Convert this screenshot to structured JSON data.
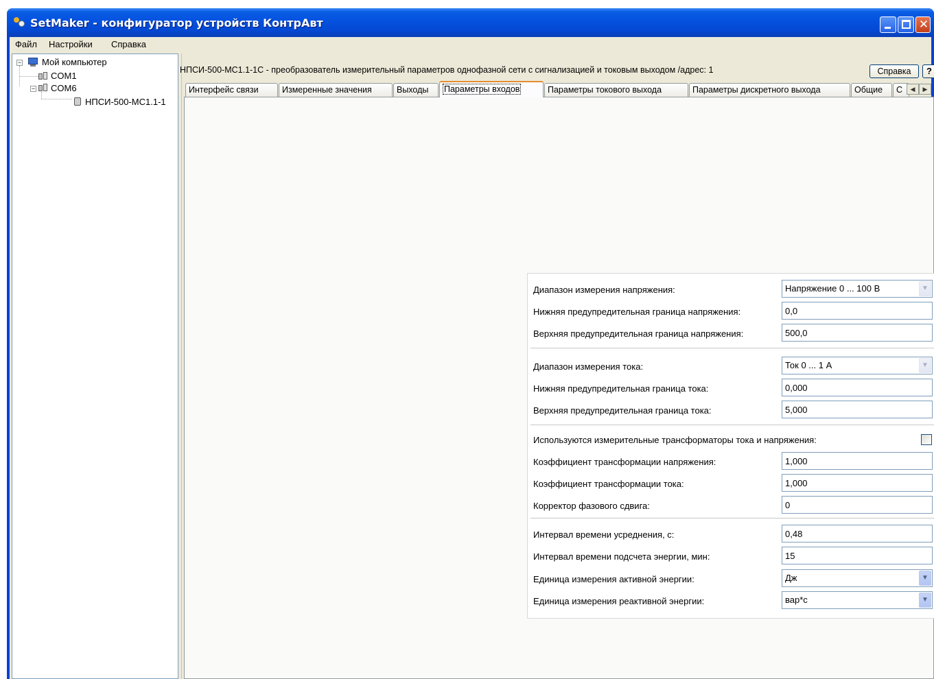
{
  "window": {
    "title": "SetMaker - конфигуратор устройств КонтрАвт",
    "close_glyph": "✕"
  },
  "menu": {
    "items": [
      "Файл",
      "Настройки",
      "Справка"
    ]
  },
  "tree": {
    "root": "Мой компьютер",
    "ports": [
      "COM1",
      "COM6"
    ],
    "device": "НПСИ-500-МС1.1-1",
    "expander_minus": "−"
  },
  "scroll": {
    "left_arrow": "◀",
    "right_arrow": "▶"
  },
  "device_header": {
    "title": "НПСИ-500-МС1.1-1С - преобразователь измерительный параметров однофазной сети с сигнализацией и токовым выходом /адрес: 1",
    "help_label": "Справка",
    "question_label": "?"
  },
  "tabs": [
    {
      "label": "Интерфейс связи"
    },
    {
      "label": "Измеренные значения"
    },
    {
      "label": "Выходы"
    },
    {
      "label": "Параметры входов",
      "active": true
    },
    {
      "label": "Параметры токового выхода"
    },
    {
      "label": "Параметры дискретного выхода"
    },
    {
      "label": "Общие"
    },
    {
      "label": "С"
    }
  ],
  "tab_scroll": {
    "left": "◀",
    "right": "▶"
  },
  "form": {
    "voltage_range": {
      "label": "Диапазон измерения напряжения:",
      "value": "Напряжение 0 ... 100 В"
    },
    "voltage_low": {
      "label": "Нижняя предупредительная граница напряжения:",
      "value": "0,0"
    },
    "voltage_high": {
      "label": "Верхняя предупредительная граница напряжения:",
      "value": "500,0"
    },
    "current_range": {
      "label": "Диапазон измерения тока:",
      "value": "Ток 0 ... 1 А"
    },
    "current_low": {
      "label": "Нижняя предупредительная граница тока:",
      "value": "0,000"
    },
    "current_high": {
      "label": "Верхняя предупредительная граница  тока:",
      "value": "5,000"
    },
    "transformers": {
      "label": "Используются измерительные трансформаторы тока и напряжения:",
      "checked": false
    },
    "voltage_ratio": {
      "label": "Коэффициент трансформации напряжения:",
      "value": "1,000"
    },
    "current_ratio": {
      "label": "Коэффициент трансформации тока:",
      "value": "1,000"
    },
    "phase_corrector": {
      "label": "Корректор фазового сдвига:",
      "value": "0"
    },
    "avg_interval": {
      "label": "Интервал времени усреднения, с:",
      "value": "0,48"
    },
    "energy_interval": {
      "label": "Интервал времени подсчета энергии, мин:",
      "value": "15"
    },
    "active_energy_unit": {
      "label": "Единица измерения активной энергии:",
      "value": "Дж"
    },
    "reactive_energy_unit": {
      "label": "Единица измерения реактивной энергии:",
      "value": "вар*с"
    },
    "dropdown_glyph": "▼"
  },
  "colors": {
    "titlebar": "#0553e0",
    "window_bg": "#ece9d8",
    "active_tab_accent": "#e68b2c",
    "input_border": "#7f9db9"
  }
}
